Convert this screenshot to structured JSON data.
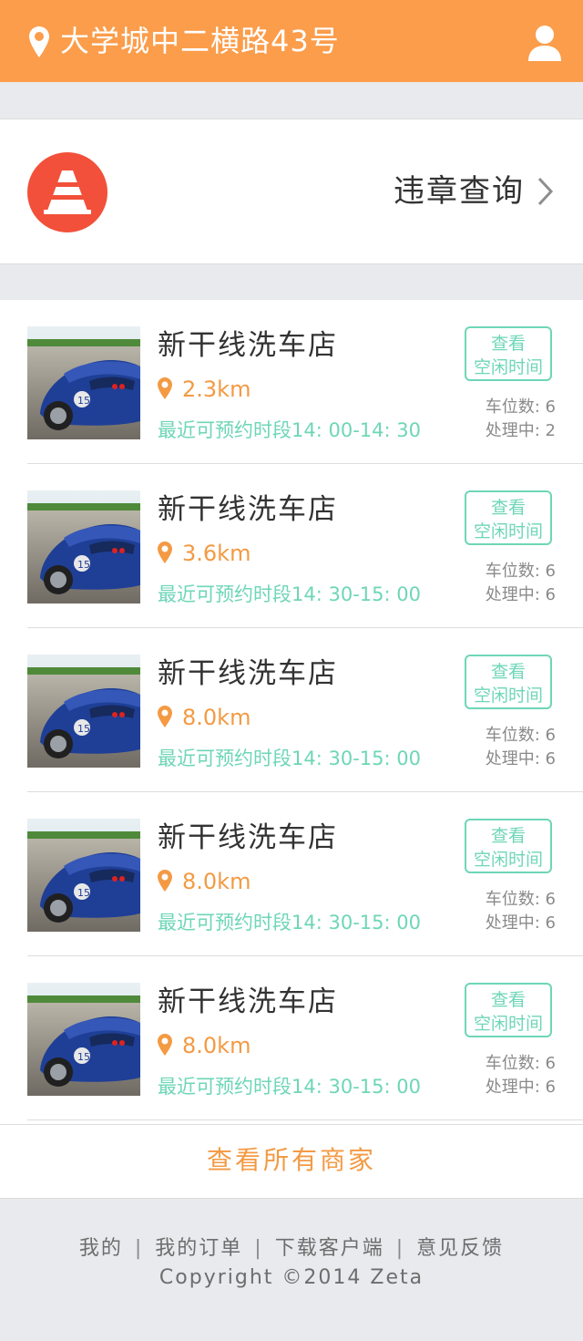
{
  "header": {
    "address": "大学城中二横路43号",
    "location_icon": "location-pin-icon",
    "user_icon": "user-profile-icon"
  },
  "violation": {
    "label": "违章查询",
    "icon": "traffic-cone-icon",
    "arrow_icon": "chevron-right-icon"
  },
  "stores": [
    {
      "name": "新干线洗车店",
      "distance": "2.3km",
      "slot": "最近可预约时段14: 00-14: 30",
      "button": "查看空闲时间",
      "bays": "车位数: 6",
      "processing": "处理中: 2"
    },
    {
      "name": "新干线洗车店",
      "distance": "3.6km",
      "slot": "最近可预约时段14: 30-15: 00",
      "button": "查看空闲时间",
      "bays": "车位数: 6",
      "processing": "处理中: 6"
    },
    {
      "name": "新干线洗车店",
      "distance": "8.0km",
      "slot": "最近可预约时段14: 30-15: 00",
      "button": "查看空闲时间",
      "bays": "车位数: 6",
      "processing": "处理中: 6"
    },
    {
      "name": "新干线洗车店",
      "distance": "8.0km",
      "slot": "最近可预约时段14: 30-15: 00",
      "button": "查看空闲时间",
      "bays": "车位数: 6",
      "processing": "处理中: 6"
    },
    {
      "name": "新干线洗车店",
      "distance": "8.0km",
      "slot": "最近可预约时段14: 30-15: 00",
      "button": "查看空闲时间",
      "bays": "车位数: 6",
      "processing": "处理中: 6"
    }
  ],
  "view_all": "查看所有商家",
  "footer": {
    "links": [
      "我的",
      "我的订单",
      "下载客户端",
      "意见反馈"
    ],
    "separator": "|",
    "copyright": "Copyright ©2014 Zeta"
  },
  "colors": {
    "header": "#fb9d4b",
    "accent_orange": "#f39a43",
    "accent_teal": "#6ed6b7",
    "cone_red": "#f2503a",
    "background": "#e9eaed"
  }
}
